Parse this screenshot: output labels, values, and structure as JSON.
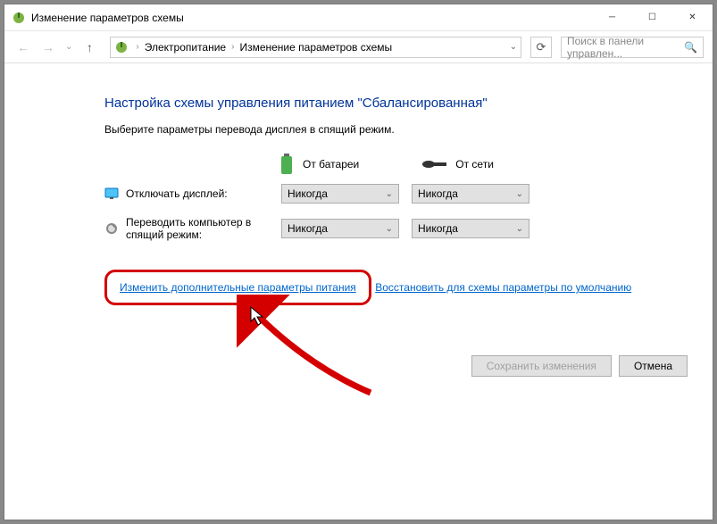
{
  "title": "Изменение параметров схемы",
  "breadcrumb": {
    "root": "Электропитание",
    "current": "Изменение параметров схемы"
  },
  "search_placeholder": "Поиск в панели управлен...",
  "heading": "Настройка схемы управления питанием \"Сбалансированная\"",
  "subtitle": "Выберите параметры перевода дисплея в спящий режим.",
  "columns": {
    "battery": "От батареи",
    "plugged": "От сети"
  },
  "rows": {
    "display": "Отключать дисплей:",
    "sleep": "Переводить компьютер в спящий режим:"
  },
  "values": {
    "display_battery": "Никогда",
    "display_plugged": "Никогда",
    "sleep_battery": "Никогда",
    "sleep_plugged": "Никогда"
  },
  "links": {
    "advanced": "Изменить дополнительные параметры питания",
    "restore": "Восстановить для схемы параметры по умолчанию"
  },
  "buttons": {
    "save": "Сохранить изменения",
    "cancel": "Отмена"
  }
}
